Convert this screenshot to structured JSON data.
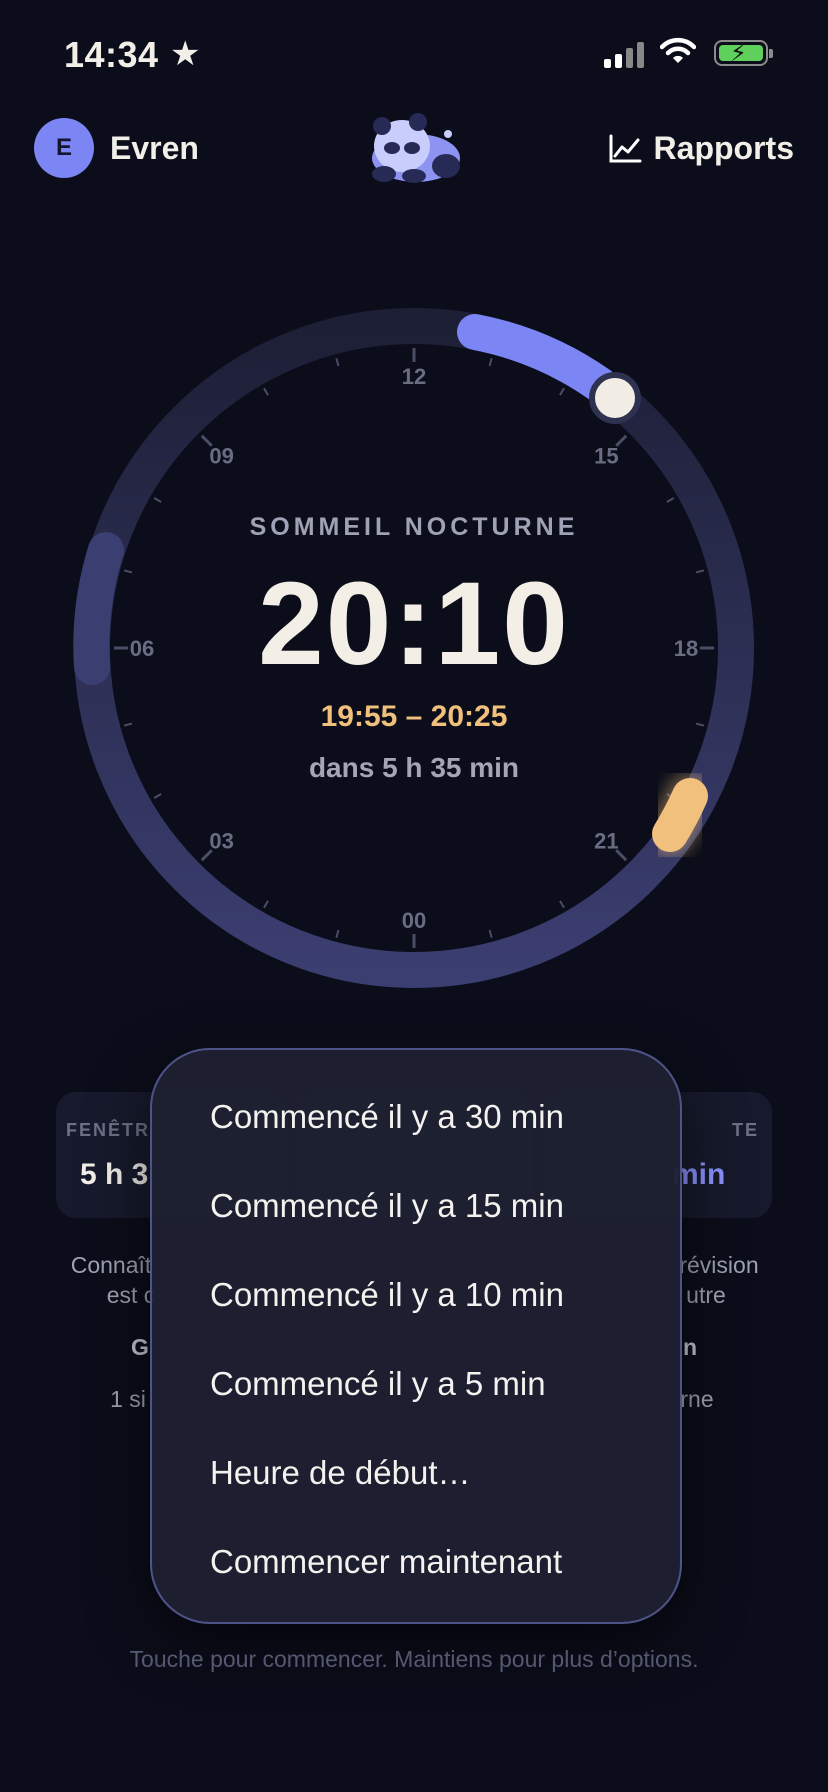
{
  "status_bar": {
    "time": "14:34",
    "star_icon": "star-icon",
    "signal_icon": "cellular-signal-icon",
    "wifi_icon": "wifi-icon",
    "battery_icon": "battery-charging-icon"
  },
  "header": {
    "avatar_initial": "E",
    "user_name": "Evren",
    "logo_icon": "sleeping-panda-icon",
    "reports_label": "Rapports",
    "reports_icon": "chart-line-icon"
  },
  "dial": {
    "hour_labels": [
      "12",
      "15",
      "18",
      "21",
      "00",
      "03",
      "06",
      "09"
    ],
    "accent_color": "#7b85f4",
    "window_color": "#f0c07c"
  },
  "center": {
    "label": "SOMMEIL NOCTURNE",
    "time": "20:10",
    "range": "19:55 – 20:25",
    "until": "dans 5 h 35 min"
  },
  "cards": {
    "left_label": "FENÊTR",
    "left_value": "5 h 3",
    "right_label": "TE",
    "right_value": "min"
  },
  "info": {
    "left_line1": "Connaît",
    "left_line2": "est c",
    "right_line1": "révision",
    "right_line2": "utre",
    "left_bold": "G",
    "right_bold": "n",
    "left_line3": "1 si",
    "right_line3": "rne"
  },
  "menu": {
    "items": [
      "Commencé il y a 30 min",
      "Commencé il y a 15 min",
      "Commencé il y a 10 min",
      "Commencé il y a 5 min",
      "Heure de début…",
      "Commencer maintenant"
    ]
  },
  "hint": "Touche pour commencer. Maintiens pour plus d’options."
}
